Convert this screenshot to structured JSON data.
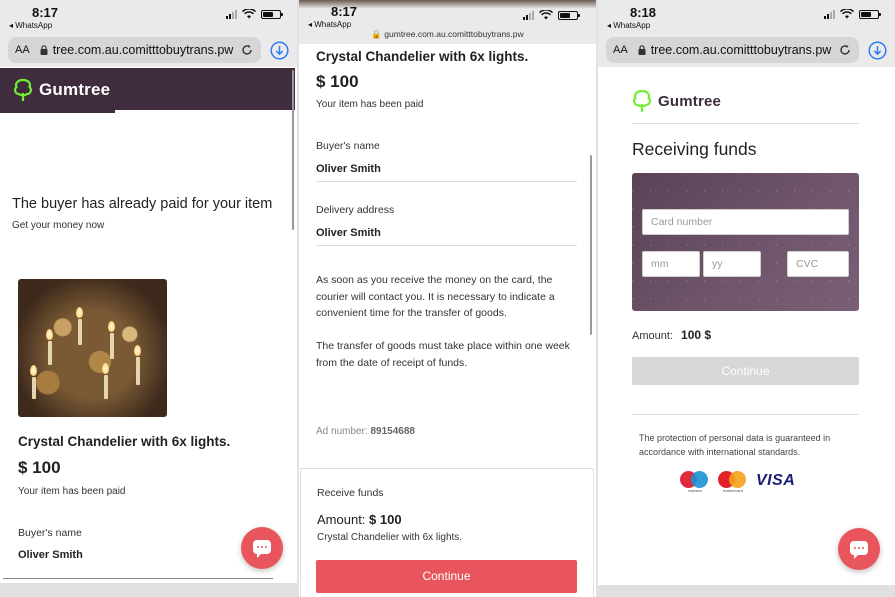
{
  "panels": [
    {
      "status": {
        "time": "8:17",
        "back_app": "◂ WhatsApp"
      },
      "url": {
        "aa": "AA",
        "text": "tree.com.au.comitttobuytrans.pw"
      },
      "logo_text": "Gumtree",
      "headline": "The buyer has already paid for your item",
      "subline": "Get your money now",
      "item_title": "Crystal Chandelier with 6x lights.",
      "price": "$ 100",
      "paid_note": "Your item has been paid",
      "buyer_label": "Buyer's name",
      "buyer_name": "Oliver Smith"
    },
    {
      "status": {
        "time": "8:17",
        "back_app": "◂ WhatsApp"
      },
      "url": {
        "text": "gumtree.com.au.comitttobuytrans.pw"
      },
      "item_title": "Crystal Chandelier with 6x lights.",
      "price": "$ 100",
      "paid_note": "Your item has been paid",
      "buyer_label": "Buyer's name",
      "buyer_name": "Oliver Smith",
      "address_label": "Delivery address",
      "address_value": "Oliver Smith",
      "para1": "As soon as you receive the money on the card, the courier will contact you. It is necessary to indicate a convenient time for the transfer of goods.",
      "para2": "The transfer of goods must take place within one week from the date of receipt of funds.",
      "ad_label": "Ad number:",
      "ad_number": "89154688",
      "receive_label": "Receive funds",
      "amount_label": "Amount:",
      "amount_value": "$ 100",
      "receive_item": "Crystal Chandelier with 6x lights.",
      "continue_label": "Continue"
    },
    {
      "status": {
        "time": "8:18",
        "back_app": "◂ WhatsApp"
      },
      "url": {
        "aa": "AA",
        "text": "tree.com.au.comitttobuytrans.pw"
      },
      "logo_text": "Gumtree",
      "heading": "Receiving funds",
      "card_number_placeholder": "Card number",
      "mm_placeholder": "mm",
      "yy_placeholder": "yy",
      "cvc_placeholder": "CVC",
      "amount_label": "Amount:",
      "amount_value": "100 $",
      "continue_label": "Continue",
      "privacy_note": "The protection of personal data is guaranteed in accordance with international standards.",
      "maestro_caption": "maestro",
      "mastercard_caption": "mastercard",
      "visa_text": "VISA"
    }
  ],
  "colors": {
    "brand_purple": "#3f2c3c",
    "brand_green": "#72ef36",
    "accent_red": "#e8555c",
    "button_grey": "#d7d7d7",
    "ios_blue": "#2f7bf5"
  }
}
